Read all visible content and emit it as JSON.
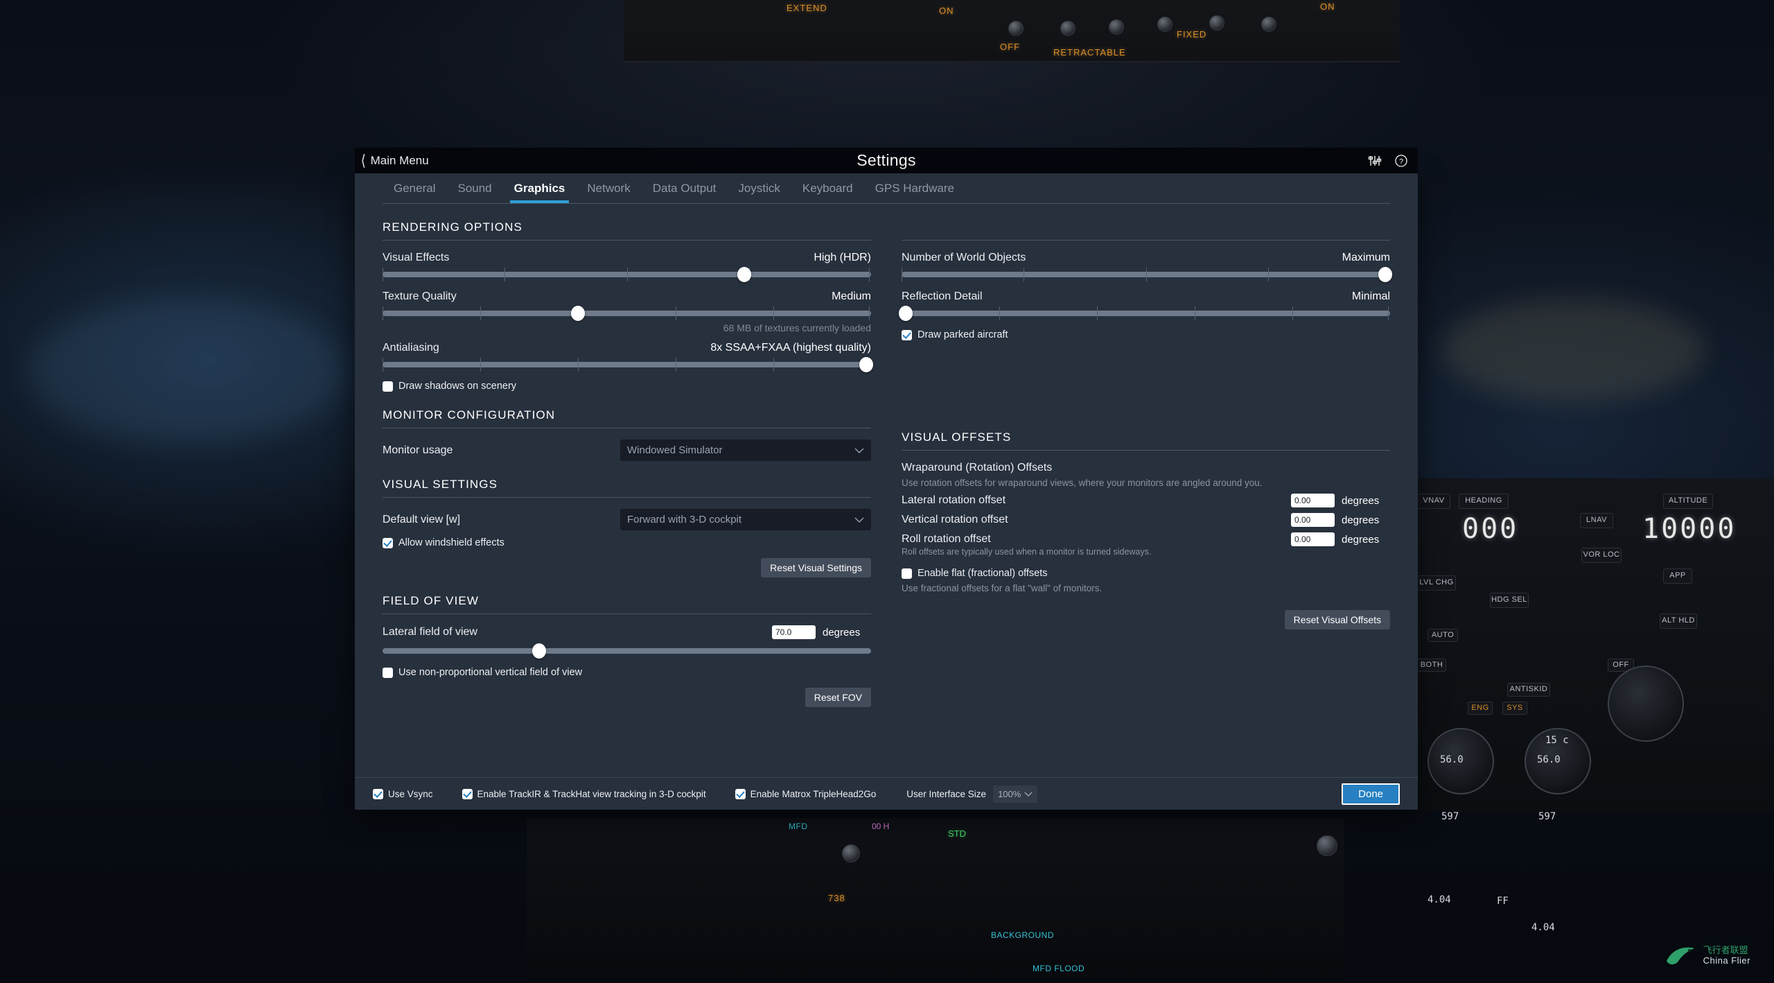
{
  "header": {
    "back_label": "Main Menu",
    "title": "Settings",
    "icons": [
      {
        "name": "sliders-icon"
      },
      {
        "name": "help-icon"
      }
    ]
  },
  "tabs": [
    {
      "label": "General",
      "active": false
    },
    {
      "label": "Sound",
      "active": false
    },
    {
      "label": "Graphics",
      "active": true
    },
    {
      "label": "Network",
      "active": false
    },
    {
      "label": "Data Output",
      "active": false
    },
    {
      "label": "Joystick",
      "active": false
    },
    {
      "label": "Keyboard",
      "active": false
    },
    {
      "label": "GPS Hardware",
      "active": false
    }
  ],
  "rendering": {
    "title": "RENDERING OPTIONS",
    "sliders_left": [
      {
        "label": "Visual Effects",
        "value_label": "High (HDR)",
        "percent": 74,
        "ticks": 4
      },
      {
        "label": "Texture Quality",
        "value_label": "Medium",
        "percent": 40,
        "ticks": 5,
        "note": "68 MB of textures currently loaded"
      },
      {
        "label": "Antialiasing",
        "value_label": "8x SSAA+FXAA (highest quality)",
        "percent": 99,
        "ticks": 5
      }
    ],
    "checkbox_left": {
      "label": "Draw shadows on scenery",
      "checked": false
    },
    "sliders_right": [
      {
        "label": "Number of World Objects",
        "value_label": "Maximum",
        "percent": 99,
        "ticks": 4
      },
      {
        "label": "Reflection Detail",
        "value_label": "Minimal",
        "percent": 1,
        "ticks": 5
      }
    ],
    "checkbox_right": {
      "label": "Draw parked aircraft",
      "checked": true
    }
  },
  "monitor": {
    "title": "MONITOR CONFIGURATION",
    "usage_label": "Monitor usage",
    "usage_value": "Windowed Simulator"
  },
  "visual_settings": {
    "title": "VISUAL SETTINGS",
    "default_view_label": "Default view [w]",
    "default_view_value": "Forward with 3-D cockpit",
    "windshield_label": "Allow windshield effects",
    "windshield_checked": true,
    "reset_label": "Reset Visual Settings"
  },
  "fov": {
    "title": "FIELD OF VIEW",
    "lateral_label": "Lateral field of view",
    "lateral_value": "70.0",
    "unit": "degrees",
    "percent": 32,
    "nonprop_label": "Use non-proportional vertical field of view",
    "nonprop_checked": false,
    "reset_label": "Reset FOV"
  },
  "offsets": {
    "title": "VISUAL OFFSETS",
    "wraparound_title": "Wraparound (Rotation) Offsets",
    "wraparound_desc": "Use rotation offsets for wraparound views, where your monitors are angled around you.",
    "rows": [
      {
        "label": "Lateral rotation offset",
        "value": "0.00",
        "unit": "degrees"
      },
      {
        "label": "Vertical rotation offset",
        "value": "0.00",
        "unit": "degrees"
      },
      {
        "label": "Roll rotation offset",
        "value": "0.00",
        "unit": "degrees"
      }
    ],
    "roll_desc": "Roll offsets are typically used when a monitor is turned sideways.",
    "flat_label": "Enable flat (fractional) offsets",
    "flat_checked": false,
    "flat_desc": "Use fractional offsets for a flat \"wall\" of monitors.",
    "reset_label": "Reset Visual Offsets"
  },
  "footer": {
    "vsync_label": "Use Vsync",
    "vsync_checked": true,
    "trackir_label": "Enable TrackIR & TrackHat view tracking in 3-D cockpit",
    "trackir_checked": true,
    "matrox_label": "Enable Matrox TripleHead2Go",
    "matrox_checked": true,
    "uisize_label": "User Interface Size",
    "uisize_value": "100%",
    "done_label": "Done"
  },
  "watermark": {
    "cn": "飞行者联盟",
    "en": "China Flier"
  },
  "cockpit": {
    "overhead_labels": [
      "EXTEND",
      "ON",
      "RETRACTABLE",
      "OFF",
      "FIXED",
      "ON"
    ],
    "mcp_buttons": [
      "HEADING",
      "ALTITUDE",
      "VNAV",
      "LNAV",
      "VOR LOC",
      "APP",
      "HDG SEL",
      "LVL CHG",
      "ALT HLD",
      "ANTISKID",
      "AUTO",
      "OFF",
      "BOTH",
      "ENG",
      "SYS"
    ],
    "displays": {
      "heading": "000",
      "altitude": "10000",
      "temp": "15 c",
      "fuel_left": "56.0",
      "fuel_right": "56.0",
      "n1_left": "597",
      "n1_right": "597",
      "ff_left": "4.04",
      "ff_right": "4.04",
      "ff_label": "FF",
      "std": "STD",
      "mfd": "MFD",
      "flaps": "738"
    }
  }
}
